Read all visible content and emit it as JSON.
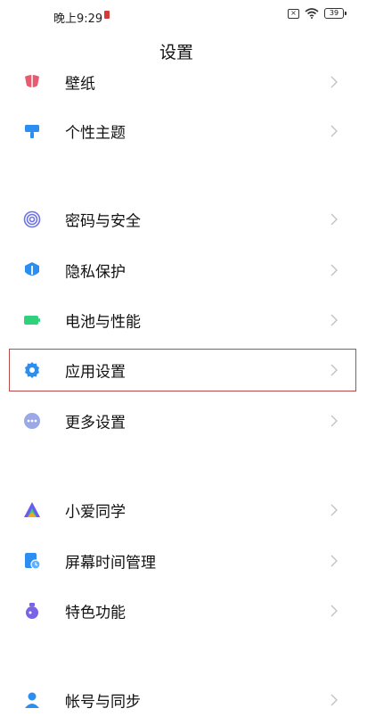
{
  "status_bar": {
    "time": "晚上9:29",
    "battery": "39"
  },
  "header": {
    "title": "设置"
  },
  "items": [
    {
      "label": "壁纸",
      "icon": "wallpaper-icon",
      "color": "#e85a6f"
    },
    {
      "label": "个性主题",
      "icon": "theme-brush-icon",
      "color": "#2b8ef0"
    },
    {
      "label": "密码与安全",
      "icon": "fingerprint-icon",
      "color": "#6e74e6"
    },
    {
      "label": "隐私保护",
      "icon": "privacy-shield-icon",
      "color": "#2b8ef0"
    },
    {
      "label": "电池与性能",
      "icon": "battery-icon",
      "color": "#2fd27a"
    },
    {
      "label": "应用设置",
      "icon": "gear-icon",
      "color": "#2b8ef0"
    },
    {
      "label": "更多设置",
      "icon": "more-dots-icon",
      "color": "#9aa9e6"
    },
    {
      "label": "小爱同学",
      "icon": "xiaoai-icon",
      "color": "#6b5cf0"
    },
    {
      "label": "屏幕时间管理",
      "icon": "screen-time-icon",
      "color": "#2b8ef0"
    },
    {
      "label": "特色功能",
      "icon": "features-flask-icon",
      "color": "#7a63e6"
    },
    {
      "label": "帐号与同步",
      "icon": "account-user-icon",
      "color": "#2b8ef0"
    }
  ],
  "highlight": {
    "item": "应用设置",
    "color": "#b94a4a"
  }
}
